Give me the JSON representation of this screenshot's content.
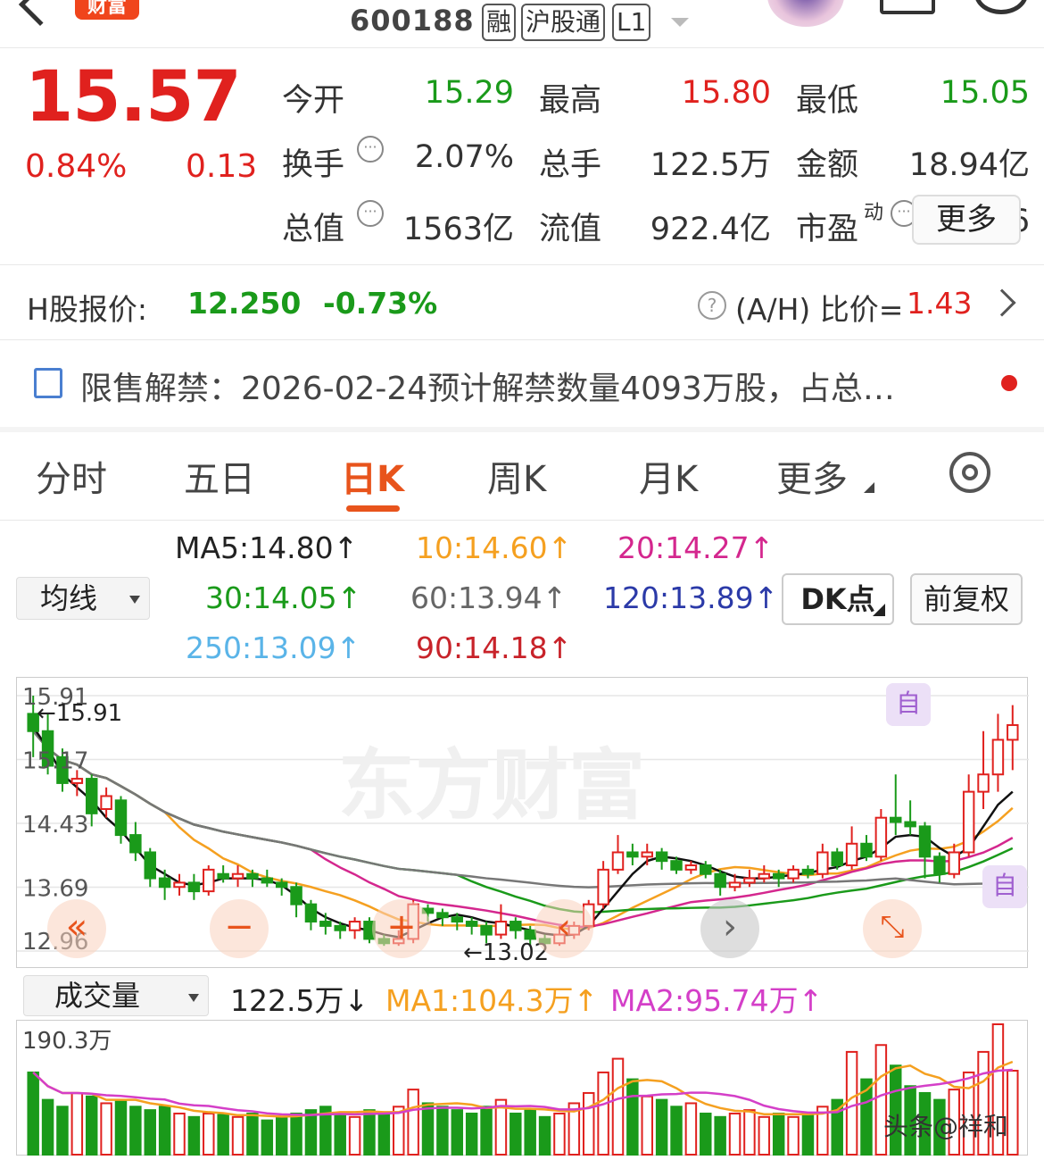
{
  "header": {
    "brand_badge": "财富",
    "stock_code": "600188",
    "tags": [
      "融",
      "沪股通",
      "L1"
    ]
  },
  "quote": {
    "price": "15.57",
    "change_pct": "0.84%",
    "change_amt": "0.13",
    "rows": [
      [
        {
          "label": "今开",
          "value": "15.29",
          "color": "green"
        },
        {
          "label": "最高",
          "value": "15.80",
          "color": "red"
        },
        {
          "label": "最低",
          "value": "15.05",
          "color": "green"
        }
      ],
      [
        {
          "label": "换手",
          "value": "2.07%",
          "color": "gray",
          "info": true
        },
        {
          "label": "总手",
          "value": "122.5万",
          "color": "gray"
        },
        {
          "label": "金额",
          "value": "18.94亿",
          "color": "gray"
        }
      ],
      [
        {
          "label": "总值",
          "value": "1563亿",
          "color": "gray",
          "info": true
        },
        {
          "label": "流值",
          "value": "922.4亿",
          "color": "gray"
        },
        {
          "label": "市盈",
          "sup": "动",
          "value": "16.46",
          "color": "gray",
          "info": true
        }
      ]
    ],
    "more_label": "更多"
  },
  "hshare": {
    "label": "H股报价:",
    "price": "12.250",
    "pct": "-0.73%",
    "ah_label": "(A/H) 比价=",
    "ah_value": "1.43"
  },
  "notice": {
    "text": "限售解禁：2026-02-24预计解禁数量4093万股，占总…"
  },
  "tabs": [
    "分时",
    "五日",
    "日K",
    "周K",
    "月K",
    "更多"
  ],
  "active_tab": 2,
  "ma_select": "均线",
  "ma_legend": [
    {
      "text": "MA5:14.80↑",
      "color": "#222222"
    },
    {
      "text": "10:14.60↑",
      "color": "#f5a020"
    },
    {
      "text": "20:14.27↑",
      "color": "#d4278e"
    },
    {
      "text": "30:14.05↑",
      "color": "#1a9a1a"
    },
    {
      "text": "60:13.94↑",
      "color": "#666666"
    },
    {
      "text": "120:13.89↑",
      "color": "#2b3aa8"
    },
    {
      "text": "250:13.09↑",
      "color": "#5ab4e8"
    },
    {
      "text": "90:14.18↑",
      "color": "#c8232a"
    }
  ],
  "dk_label": "DK点",
  "restore_label": "前复权",
  "kline": {
    "price_labels": [
      "15.91",
      "15.17",
      "14.43",
      "13.69",
      "12.96"
    ],
    "high_marker": "←15.91",
    "low_marker": "←13.02",
    "signal_marker": "自",
    "watermark": "东方财富"
  },
  "volume": {
    "select": "成交量",
    "current": "122.5万↓",
    "ma1": "MA1:104.3万↑",
    "ma2": "MA2:95.74万↑",
    "max_label": "190.3万",
    "credit": "头条@祥和"
  },
  "colors": {
    "up": "#e0211e",
    "down": "#1a9a1a",
    "accent": "#e8541c"
  },
  "chart_data": {
    "type": "candlestick",
    "ylim": [
      12.96,
      15.91
    ],
    "candles": [
      [
        15.7,
        15.5,
        15.91,
        15.2
      ],
      [
        15.5,
        15.1,
        15.7,
        15.0
      ],
      [
        15.2,
        14.9,
        15.3,
        14.8
      ],
      [
        14.9,
        14.95,
        15.05,
        14.75
      ],
      [
        14.95,
        14.55,
        15.0,
        14.4
      ],
      [
        14.6,
        14.75,
        14.85,
        14.5
      ],
      [
        14.7,
        14.3,
        14.75,
        14.2
      ],
      [
        14.3,
        14.1,
        14.45,
        14.0
      ],
      [
        14.1,
        13.8,
        14.15,
        13.7
      ],
      [
        13.8,
        13.7,
        13.9,
        13.55
      ],
      [
        13.7,
        13.75,
        13.85,
        13.6
      ],
      [
        13.75,
        13.65,
        13.85,
        13.55
      ],
      [
        13.65,
        13.9,
        13.95,
        13.6
      ],
      [
        13.85,
        13.8,
        13.95,
        13.75
      ],
      [
        13.8,
        13.85,
        13.95,
        13.7
      ],
      [
        13.85,
        13.8,
        13.9,
        13.7
      ],
      [
        13.8,
        13.75,
        13.9,
        13.7
      ],
      [
        13.75,
        13.7,
        13.8,
        13.6
      ],
      [
        13.7,
        13.5,
        13.75,
        13.35
      ],
      [
        13.5,
        13.3,
        13.55,
        13.2
      ],
      [
        13.3,
        13.25,
        13.4,
        13.15
      ],
      [
        13.25,
        13.2,
        13.3,
        13.1
      ],
      [
        13.2,
        13.3,
        13.35,
        13.1
      ],
      [
        13.3,
        13.1,
        13.35,
        13.05
      ],
      [
        13.1,
        13.05,
        13.15,
        13.02
      ],
      [
        13.05,
        13.1,
        13.2,
        13.02
      ],
      [
        13.1,
        13.5,
        13.55,
        13.05
      ],
      [
        13.45,
        13.4,
        13.5,
        13.3
      ],
      [
        13.4,
        13.35,
        13.45,
        13.25
      ],
      [
        13.35,
        13.3,
        13.4,
        13.2
      ],
      [
        13.3,
        13.25,
        13.35,
        13.15
      ],
      [
        13.25,
        13.15,
        13.3,
        13.05
      ],
      [
        13.15,
        13.3,
        13.5,
        13.1
      ],
      [
        13.3,
        13.2,
        13.35,
        13.1
      ],
      [
        13.2,
        13.1,
        13.25,
        13.02
      ],
      [
        13.1,
        13.05,
        13.15,
        13.02
      ],
      [
        13.05,
        13.15,
        13.25,
        13.02
      ],
      [
        13.15,
        13.25,
        13.3,
        13.1
      ],
      [
        13.25,
        13.5,
        13.55,
        13.2
      ],
      [
        13.5,
        13.9,
        14.0,
        13.45
      ],
      [
        13.9,
        14.1,
        14.3,
        13.85
      ],
      [
        14.1,
        14.05,
        14.2,
        13.95
      ],
      [
        14.05,
        14.1,
        14.2,
        13.95
      ],
      [
        14.1,
        14.0,
        14.15,
        13.9
      ],
      [
        14.0,
        13.9,
        14.05,
        13.85
      ],
      [
        13.9,
        13.95,
        14.0,
        13.85
      ],
      [
        13.95,
        13.85,
        14.0,
        13.8
      ],
      [
        13.85,
        13.7,
        13.9,
        13.6
      ],
      [
        13.7,
        13.75,
        13.85,
        13.65
      ],
      [
        13.75,
        13.8,
        13.9,
        13.7
      ],
      [
        13.8,
        13.85,
        13.95,
        13.75
      ],
      [
        13.85,
        13.8,
        13.9,
        13.7
      ],
      [
        13.8,
        13.9,
        13.95,
        13.75
      ],
      [
        13.9,
        13.85,
        13.95,
        13.8
      ],
      [
        13.85,
        14.1,
        14.2,
        13.8
      ],
      [
        14.1,
        13.95,
        14.15,
        13.9
      ],
      [
        13.95,
        14.2,
        14.4,
        13.9
      ],
      [
        14.2,
        14.05,
        14.3,
        14.0
      ],
      [
        14.05,
        14.5,
        14.6,
        14.0
      ],
      [
        14.5,
        14.45,
        15.0,
        14.3
      ],
      [
        14.45,
        14.4,
        14.7,
        14.3
      ],
      [
        14.4,
        14.05,
        14.45,
        13.8
      ],
      [
        14.05,
        13.85,
        14.1,
        13.75
      ],
      [
        13.85,
        14.1,
        14.2,
        13.8
      ],
      [
        14.1,
        14.8,
        15.0,
        14.05
      ],
      [
        14.8,
        15.0,
        15.5,
        14.6
      ],
      [
        15.0,
        15.4,
        15.7,
        14.8
      ],
      [
        15.4,
        15.57,
        15.8,
        15.05
      ]
    ],
    "volumes": [
      120,
      80,
      70,
      90,
      85,
      75,
      80,
      70,
      65,
      70,
      60,
      55,
      60,
      58,
      55,
      60,
      50,
      55,
      60,
      65,
      70,
      60,
      55,
      65,
      60,
      70,
      95,
      75,
      70,
      65,
      60,
      70,
      80,
      60,
      65,
      55,
      60,
      75,
      90,
      120,
      140,
      110,
      85,
      80,
      70,
      75,
      60,
      55,
      60,
      65,
      55,
      60,
      55,
      60,
      70,
      80,
      150,
      110,
      160,
      130,
      100,
      90,
      80,
      95,
      120,
      150,
      190.3,
      122.5
    ],
    "ma5": [
      15.55,
      15.3,
      15.0,
      14.85,
      14.7,
      14.5,
      14.35,
      14.15,
      13.95,
      13.85,
      13.75,
      13.72,
      13.75,
      13.8,
      13.8,
      13.8,
      13.78,
      13.72,
      13.6,
      13.45,
      13.35,
      13.28,
      13.23,
      13.2,
      13.15,
      13.12,
      13.2,
      13.28,
      13.35,
      13.38,
      13.35,
      13.3,
      13.28,
      13.24,
      13.2,
      13.16,
      13.14,
      13.15,
      13.25,
      13.45,
      13.65,
      13.85,
      14.0,
      14.05,
      14.03,
      14.0,
      13.95,
      13.88,
      13.82,
      13.8,
      13.8,
      13.82,
      13.84,
      13.86,
      13.9,
      13.93,
      14.0,
      14.05,
      14.15,
      14.28,
      14.3,
      14.28,
      14.15,
      14.05,
      14.15,
      14.4,
      14.65,
      14.8
    ],
    "ylabel": ""
  }
}
